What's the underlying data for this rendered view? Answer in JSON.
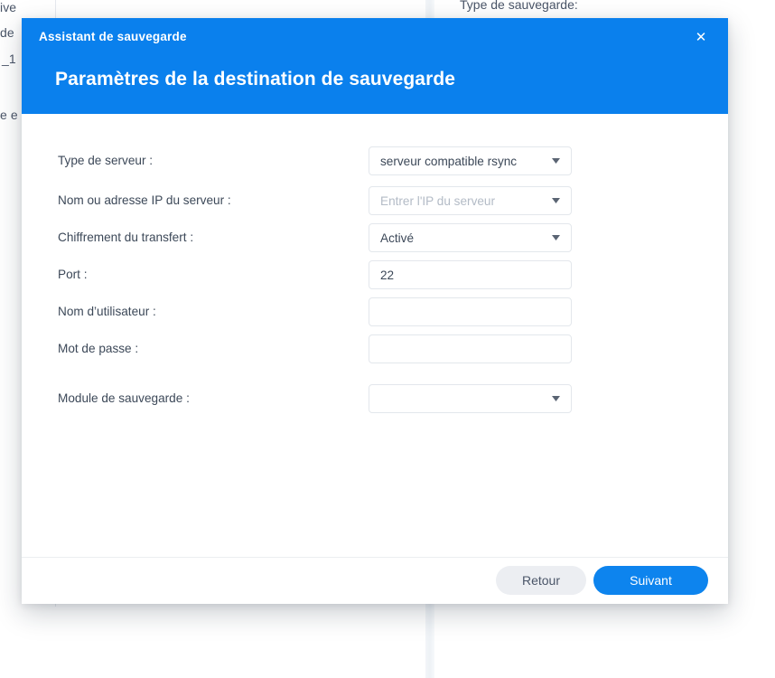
{
  "background": {
    "fragments": {
      "ive": "ive",
      "de": "de",
      "one": "_1",
      "ee": "e e"
    },
    "backup_type_label": "Type de sauvegarde:"
  },
  "modal": {
    "window_title": "Assistant de sauvegarde",
    "close_icon": "✕",
    "heading": "Paramètres de la destination de sauvegarde",
    "fields": [
      {
        "key": "server_type",
        "label": "Type de serveur :",
        "value": "serveur compatible rsync",
        "placeholder": "",
        "control": "select"
      },
      {
        "key": "server_address",
        "label": "Nom ou adresse IP du serveur :",
        "value": "",
        "placeholder": "Entrer l'IP du serveur",
        "control": "select"
      },
      {
        "key": "encryption",
        "label": "Chiffrement du transfert :",
        "value": "Activé",
        "placeholder": "",
        "control": "select"
      },
      {
        "key": "port",
        "label": "Port :",
        "value": "22",
        "placeholder": "",
        "control": "text"
      },
      {
        "key": "username",
        "label": "Nom d’utilisateur :",
        "value": "",
        "placeholder": "",
        "control": "text"
      },
      {
        "key": "password",
        "label": "Mot de passe :",
        "value": "",
        "placeholder": "",
        "control": "text"
      },
      {
        "key": "backup_module",
        "label": "Module de sauvegarde :",
        "value": "",
        "placeholder": "",
        "control": "select"
      }
    ],
    "footer": {
      "back_label": "Retour",
      "next_label": "Suivant"
    }
  },
  "colors": {
    "header_blue": "#0a80ed",
    "primary_button_blue": "#0d84ee",
    "secondary_button_grey": "#eceef2",
    "field_border": "#e3e7ec",
    "text": "#3c4858",
    "placeholder": "#b3bbc6"
  }
}
